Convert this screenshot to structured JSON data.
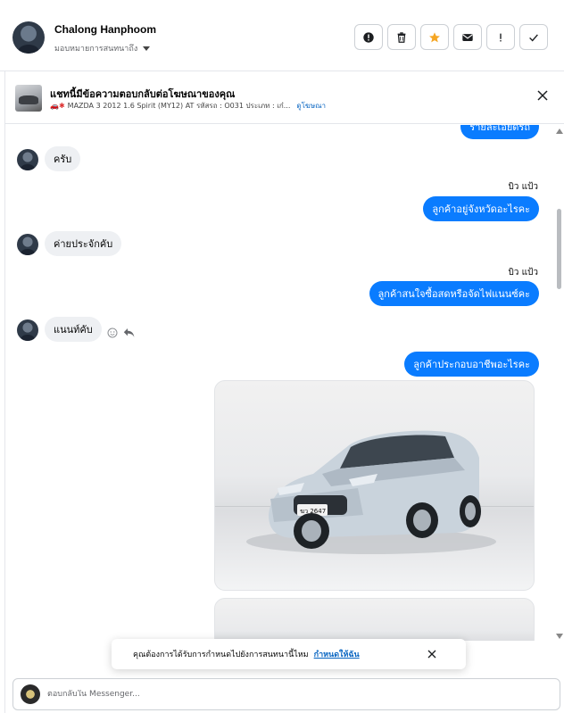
{
  "header": {
    "user_name": "Chalong Hanphoom",
    "assign_label": "มอบหมายการสนทนาถึง",
    "actions": [
      "report",
      "delete",
      "star",
      "mark-unread",
      "spam",
      "done"
    ]
  },
  "ad_banner": {
    "title": "แชทนี้มีข้อความตอบกลับต่อโฆษณาของคุณ",
    "subtitle": "MAZDA 3 2012 1.6 Spirit (MY12) AT รหัสรถ : O031 ประเภท : เก๋...",
    "link": "ดูโฆษณา"
  },
  "messages": {
    "m0_out": "รายละเอียดรถ",
    "m1_in": "ครับ",
    "m2_sender": "บิว แป้ว",
    "m2_out": "ลูกค้าอยู่จังหวัดอะไรคะ",
    "m3_in": "ค่ายประจักคับ",
    "m4_sender": "บิว แป้ว",
    "m4_out": "ลูกค้าสนใจซื้อสดหรือจัดไฟแนนซ์คะ",
    "m5_in": "แนนท์คับ",
    "m6_out": "ลูกค้าประกอบอาชีพอะไรคะ"
  },
  "photo": {
    "plate_text": "ฆว 2647"
  },
  "toast": {
    "text": "คุณต้องการได้รับการกำหนดไปยังการสนทนานี้ไหม",
    "link": "กำหนดให้ฉัน"
  },
  "composer": {
    "placeholder": "ตอบกลับใน Messenger..."
  },
  "colors": {
    "accent": "#0a7cff",
    "star": "#f5a623"
  }
}
